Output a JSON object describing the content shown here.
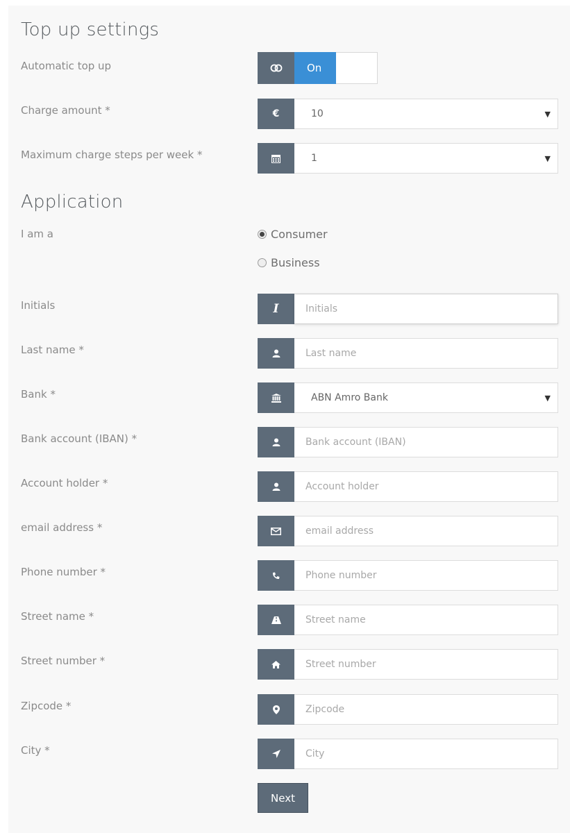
{
  "topup": {
    "title": "Top up settings",
    "automatic_label": "Automatic top up",
    "toggle_on_label": "On",
    "charge_label": "Charge amount *",
    "charge_value": "10",
    "charge_icon": "€",
    "steps_label": "Maximum charge steps per week *",
    "steps_value": "1"
  },
  "application": {
    "title": "Application",
    "iam_label": "I am a",
    "options": [
      "Consumer",
      "Business"
    ],
    "selected_option": "Consumer",
    "fields": {
      "initials": {
        "label": "Initials",
        "placeholder": "Initials"
      },
      "last_name": {
        "label": "Last name *",
        "placeholder": "Last name"
      },
      "bank": {
        "label": "Bank *",
        "value": "ABN Amro Bank"
      },
      "iban": {
        "label": "Bank account (IBAN) *",
        "placeholder": "Bank account (IBAN)"
      },
      "holder": {
        "label": "Account holder *",
        "placeholder": "Account holder"
      },
      "email": {
        "label": "email address *",
        "placeholder": "email address"
      },
      "phone": {
        "label": "Phone number *",
        "placeholder": "Phone number"
      },
      "street": {
        "label": "Street name *",
        "placeholder": "Street name"
      },
      "street_number": {
        "label": "Street number *",
        "placeholder": "Street number"
      },
      "zipcode": {
        "label": "Zipcode *",
        "placeholder": "Zipcode"
      },
      "city": {
        "label": "City *",
        "placeholder": "City"
      }
    },
    "next_label": "Next"
  },
  "colors": {
    "addon": "#5d6b79",
    "toggle_on": "#3a8fd6",
    "background": "#f8f8f8"
  }
}
